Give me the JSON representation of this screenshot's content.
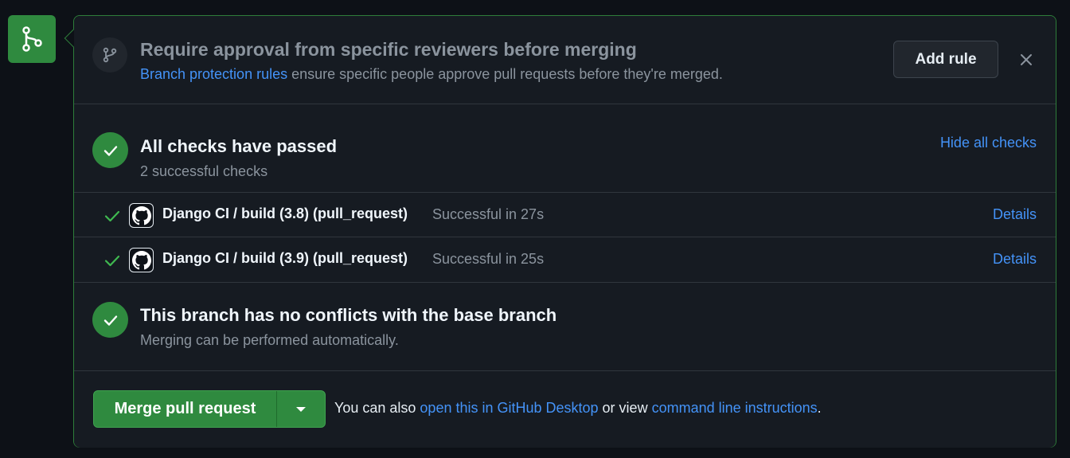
{
  "rule": {
    "title": "Require approval from specific reviewers before merging",
    "desc_link": "Branch protection rules",
    "desc_rest": " ensure specific people approve pull requests before they're merged.",
    "add_rule_label": "Add rule",
    "close_icon": "close-icon"
  },
  "checks": {
    "title": "All checks have passed",
    "subtitle": "2 successful checks",
    "hide_label": "Hide all checks",
    "items": [
      {
        "name": "Django CI / build (3.8) (pull_request)",
        "status": "Successful in 27s",
        "details": "Details"
      },
      {
        "name": "Django CI / build (3.9) (pull_request)",
        "status": "Successful in 25s",
        "details": "Details"
      }
    ]
  },
  "conflicts": {
    "title": "This branch has no conflicts with the base branch",
    "subtitle": "Merging can be performed automatically."
  },
  "merge": {
    "button_label": "Merge pull request",
    "note_prefix": "You can also ",
    "desktop_link": "open this in GitHub Desktop",
    "note_middle": " or view ",
    "cli_link": "command line instructions",
    "note_suffix": "."
  },
  "colors": {
    "success": "#2f8a3f",
    "link": "#4493f8",
    "border_green": "#2e7d3a"
  }
}
